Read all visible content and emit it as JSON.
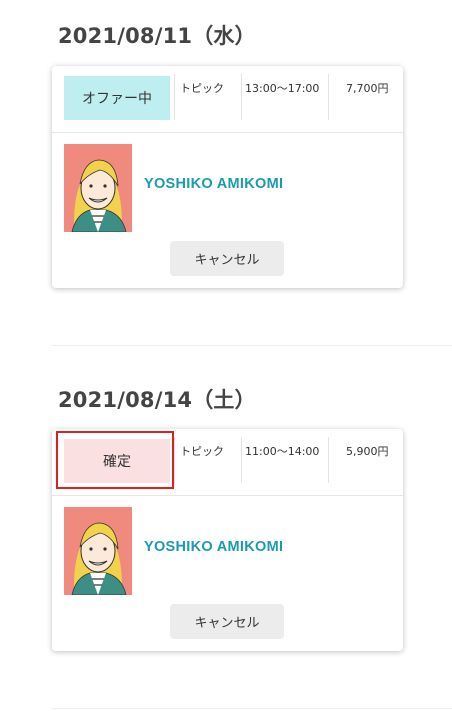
{
  "schedule": [
    {
      "date": "2021/08/11（水）",
      "status": "オファー中",
      "topic": "トピック",
      "time": "13:00〜17:00",
      "price": "7,700円",
      "name": "YOSHIKO AMIKOMI",
      "cancel_label": "キャンセル"
    },
    {
      "date": "2021/08/14（土）",
      "status": "確定",
      "topic": "トピック",
      "time": "11:00〜14:00",
      "price": "5,900円",
      "name": "YOSHIKO AMIKOMI",
      "cancel_label": "キャンセル"
    }
  ],
  "colors": {
    "offer_badge": "#bfeef0",
    "confirmed_badge": "#fbe0e1",
    "name_accent": "#1a9bb0",
    "highlight_border": "#e02020"
  }
}
